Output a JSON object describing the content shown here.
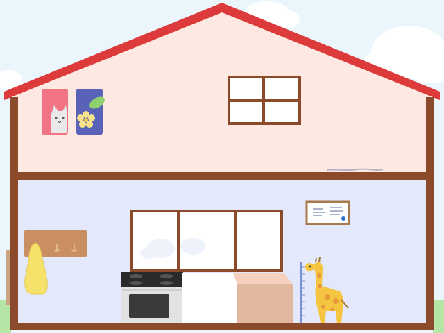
{
  "scene": {
    "title": "",
    "rooms": [
      "upper-floor",
      "lower-floor"
    ],
    "objects": {
      "upper": [
        "cat-poster",
        "flower-poster",
        "upper-window",
        "wall-label"
      ],
      "lower": [
        "coat-rack",
        "yellow-raincoat",
        "lower-window",
        "stove",
        "counter",
        "notice-board",
        "height-chart",
        "giraffe-toy"
      ]
    }
  },
  "colors": {
    "sky": "#eaf6fb",
    "roof": "#dd3b3b",
    "frame": "#8b4a2a",
    "upper_wall": "#fde9e2",
    "lower_wall": "#e3e8fb",
    "grass": "#b5e6a6",
    "counter": "#e1b7a0",
    "counter_top": "#f7cfbd",
    "giraffe": "#f5c542",
    "giraffe_spots": "#e89a3a",
    "raincoat": "#f6e26a",
    "cat_poster": "#f07483",
    "flower_poster": "#5a62b8"
  }
}
